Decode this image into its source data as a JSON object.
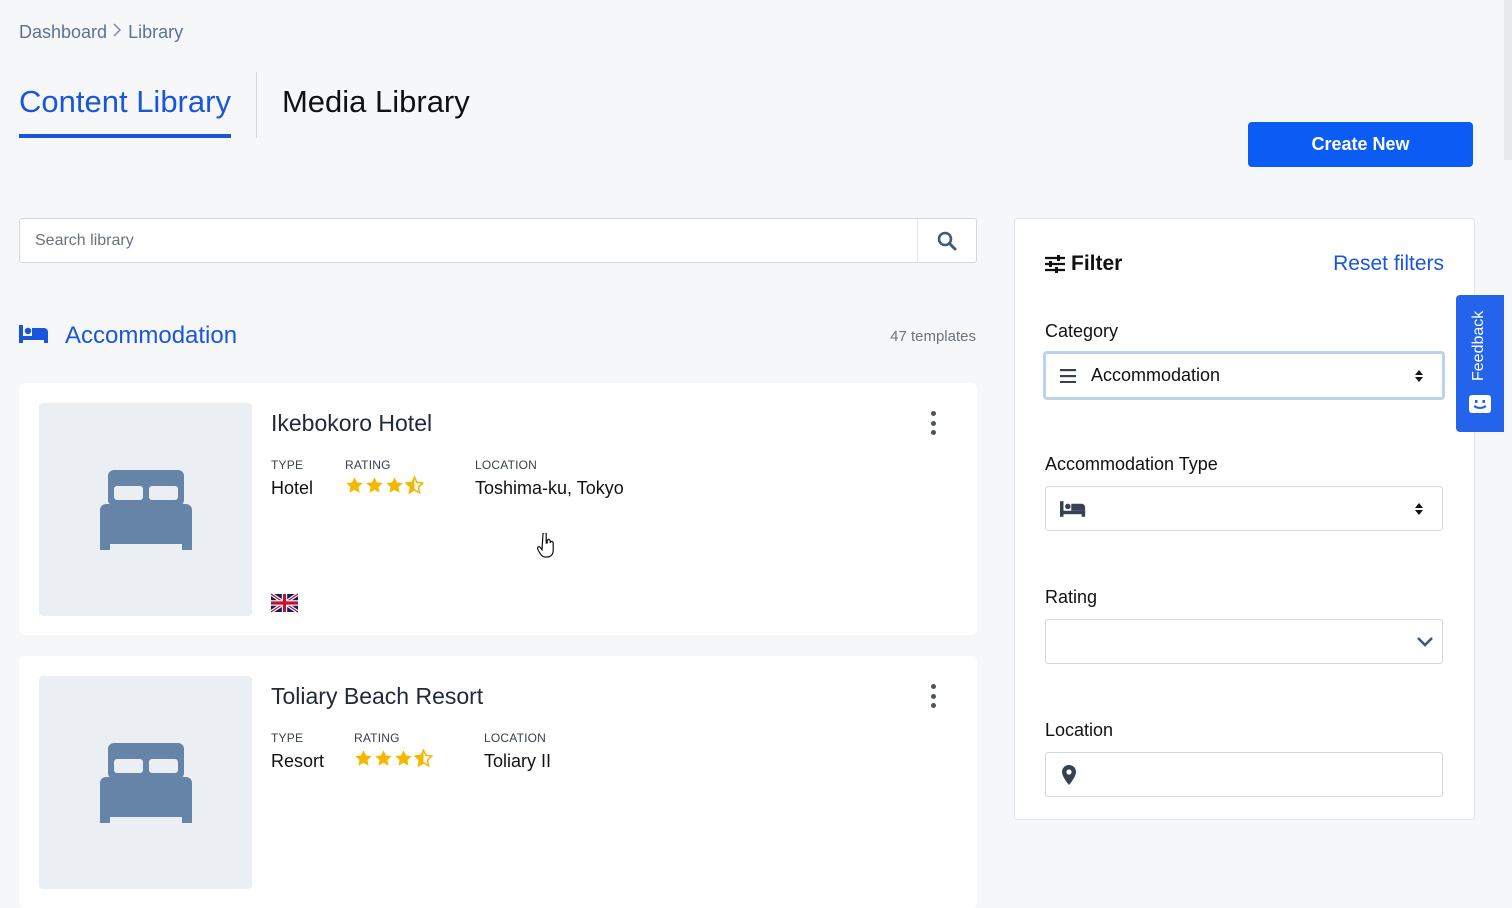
{
  "breadcrumb": {
    "home": "Dashboard",
    "current": "Library"
  },
  "tabs": {
    "content": "Content Library",
    "media": "Media Library"
  },
  "actions": {
    "create_new": "Create New"
  },
  "search": {
    "placeholder": "Search library"
  },
  "section": {
    "title": "Accommodation",
    "count": "47 templates"
  },
  "meta_labels": {
    "type": "TYPE",
    "rating": "RATING",
    "location": "LOCATION"
  },
  "cards": [
    {
      "name": "Ikebokoro Hotel",
      "type": "Hotel",
      "rating": 3.5,
      "location": "Toshima-ku, Tokyo",
      "language_flag": "uk-flag"
    },
    {
      "name": "Toliary Beach Resort",
      "type": "Resort",
      "rating": 3.5,
      "location": "Toliary II"
    }
  ],
  "filter": {
    "title": "Filter",
    "reset": "Reset filters",
    "category_label": "Category",
    "category_value": "Accommodation",
    "accommodation_type_label": "Accommodation Type",
    "rating_label": "Rating",
    "location_label": "Location"
  },
  "feedback": {
    "label": "Feedback"
  },
  "colors": {
    "accent": "#1a56db",
    "button": "#0a5cf5",
    "star": "#f5b800",
    "icon": "#6b87a8"
  }
}
